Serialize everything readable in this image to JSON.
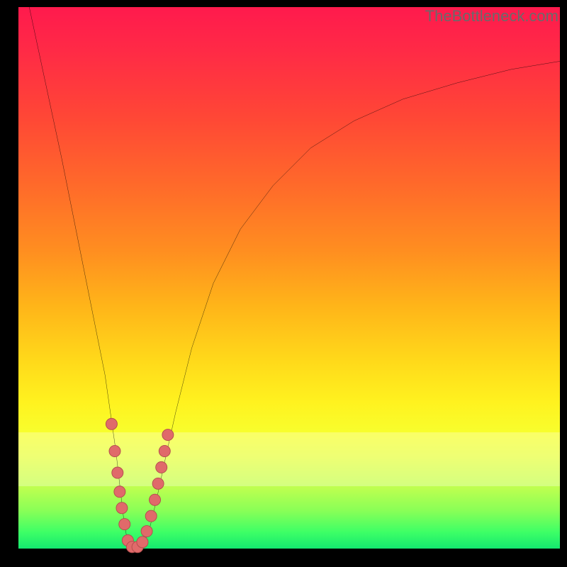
{
  "watermark": "TheBottleneck.com",
  "colors": {
    "frame": "#000000",
    "curve": "#000000",
    "dot_fill": "#e06a6a",
    "dot_stroke": "#b24c4c"
  },
  "chart_data": {
    "type": "line",
    "title": "",
    "xlabel": "",
    "ylabel": "",
    "xlim": [
      0,
      100
    ],
    "ylim": [
      0,
      100
    ],
    "grid": false,
    "series": [
      {
        "name": "bottleneck-curve",
        "x": [
          2,
          5,
          8,
          10,
          12,
          14,
          16,
          17,
          18,
          18.8,
          19.5,
          20.2,
          21,
          22,
          23.2,
          24.3,
          25.5,
          27,
          29,
          32,
          36,
          41,
          47,
          54,
          62,
          71,
          81,
          91,
          100
        ],
        "y": [
          100,
          86,
          72,
          62,
          52,
          42,
          32,
          25,
          18,
          11,
          5,
          1,
          0,
          0,
          1,
          4,
          9,
          16,
          25,
          37,
          49,
          59,
          67,
          74,
          79,
          83,
          86,
          88.5,
          90
        ]
      }
    ],
    "dots": [
      {
        "x": 17.2,
        "y": 23
      },
      {
        "x": 17.8,
        "y": 18
      },
      {
        "x": 18.3,
        "y": 14
      },
      {
        "x": 18.7,
        "y": 10.5
      },
      {
        "x": 19.1,
        "y": 7.5
      },
      {
        "x": 19.6,
        "y": 4.5
      },
      {
        "x": 20.2,
        "y": 1.5
      },
      {
        "x": 21.0,
        "y": 0.3
      },
      {
        "x": 22.0,
        "y": 0.3
      },
      {
        "x": 22.9,
        "y": 1.2
      },
      {
        "x": 23.7,
        "y": 3.2
      },
      {
        "x": 24.5,
        "y": 6.0
      },
      {
        "x": 25.2,
        "y": 9.0
      },
      {
        "x": 25.8,
        "y": 12.0
      },
      {
        "x": 26.4,
        "y": 15.0
      },
      {
        "x": 27.0,
        "y": 18.0
      },
      {
        "x": 27.6,
        "y": 21.0
      }
    ]
  }
}
